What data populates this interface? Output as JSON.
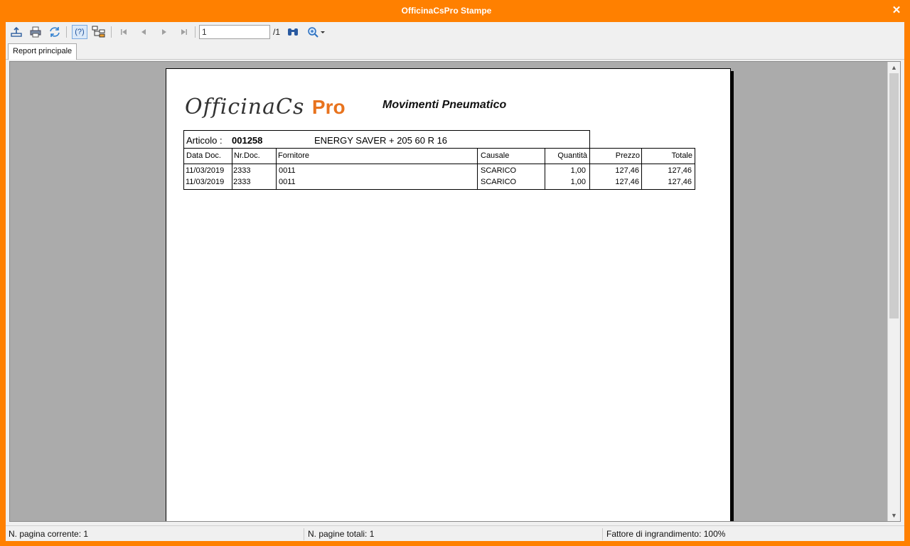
{
  "window": {
    "title": "OfficinaCsPro Stampe",
    "close_glyph": "✕"
  },
  "toolbar": {
    "buttons": [
      {
        "name": "export-icon",
        "tooltip": ""
      },
      {
        "name": "print-icon",
        "tooltip": ""
      },
      {
        "name": "refresh-icon",
        "tooltip": ""
      },
      {
        "name": "help-icon",
        "tooltip": ""
      },
      {
        "name": "group-tree-icon",
        "tooltip": ""
      },
      {
        "name": "first-page-icon",
        "tooltip": ""
      },
      {
        "name": "prev-page-icon",
        "tooltip": ""
      },
      {
        "name": "next-page-icon",
        "tooltip": ""
      },
      {
        "name": "last-page-icon",
        "tooltip": ""
      },
      {
        "name": "search-binoculars-icon",
        "tooltip": ""
      },
      {
        "name": "zoom-icon",
        "tooltip": ""
      }
    ],
    "help_label": "(?)",
    "page_value": "1",
    "page_total": "/1"
  },
  "tabs": [
    {
      "label": "Report principale",
      "active": true
    }
  ],
  "report": {
    "logo_main": "OfficinaCs",
    "logo_pro": "Pro",
    "title": "Movimenti Pneumatico",
    "article_label": "Articolo :",
    "article_code": "001258",
    "article_desc": "ENERGY SAVER + 205 60 R 16",
    "columns": {
      "date": "Data Doc.",
      "docnum": "Nr.Doc.",
      "supplier": "Fornitore",
      "reason": "Causale",
      "qty": "Quantità",
      "price": "Prezzo",
      "total": "Totale"
    },
    "rows": [
      {
        "date": "11/03/2019",
        "docnum": "2333",
        "supplier": "0011",
        "reason": "SCARICO",
        "qty": "1,00",
        "price": "127,46",
        "total": "127,46"
      },
      {
        "date": "11/03/2019",
        "docnum": "2333",
        "supplier": "0011",
        "reason": "SCARICO",
        "qty": "1,00",
        "price": "127,46",
        "total": "127,46"
      }
    ]
  },
  "status": {
    "current_page": "N. pagina corrente: 1",
    "total_pages": "N. pagine totali: 1",
    "zoom": "Fattore di ingrandimento: 100%"
  },
  "colors": {
    "accent": "#ff8000",
    "logo_pro": "#e8731e",
    "viewer_bg": "#ababab"
  }
}
